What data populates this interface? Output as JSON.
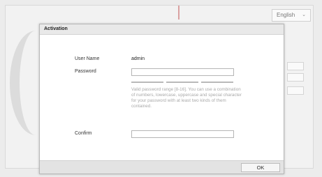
{
  "background": {
    "language_select": {
      "value": "English",
      "icon": "chevron-down-icon"
    }
  },
  "dialog": {
    "title": "Activation",
    "username_label": "User Name",
    "username_value": "admin",
    "password_label": "Password",
    "password_value": "",
    "password_hint": "Valid password range [8-16]. You can use a combination of numbers, lowercase, uppercase and special character for your password with at least two kinds of them contained.",
    "confirm_label": "Confirm",
    "confirm_value": "",
    "ok_label": "OK"
  }
}
